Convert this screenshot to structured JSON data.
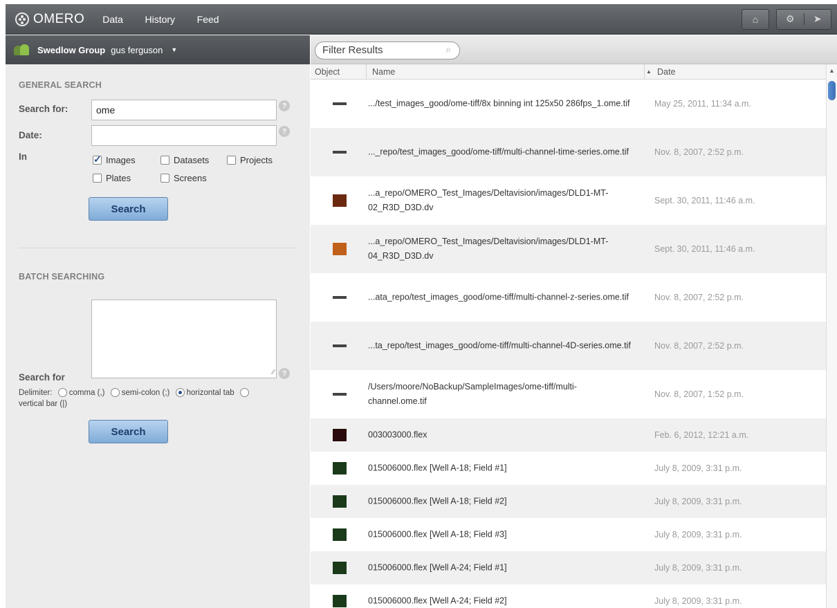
{
  "app": {
    "name": "OMERO",
    "nav": [
      "Data",
      "History",
      "Feed"
    ]
  },
  "group": {
    "name": "Swedlow Group",
    "user": "gus ferguson"
  },
  "general_search": {
    "title": "GENERAL SEARCH",
    "search_for_label": "Search for:",
    "search_for_value": "ome",
    "date_label": "Date:",
    "date_value": "",
    "in_label": "In",
    "scopes": [
      {
        "label": "Images",
        "checked": true
      },
      {
        "label": "Datasets",
        "checked": false
      },
      {
        "label": "Projects",
        "checked": false
      },
      {
        "label": "Plates",
        "checked": false
      },
      {
        "label": "Screens",
        "checked": false
      }
    ],
    "help": "?",
    "button": "Search"
  },
  "batch_search": {
    "title": "BATCH SEARCHING",
    "search_for_label": "Search for",
    "delimiter_label": "Delimiter:",
    "delimiters": [
      {
        "label": "comma (,)",
        "selected": false
      },
      {
        "label": "semi-colon (;)",
        "selected": false
      },
      {
        "label": "horizontal tab",
        "selected": true
      },
      {
        "label": "vertical bar (|)",
        "selected": false
      }
    ],
    "button": "Search"
  },
  "results": {
    "filter_placeholder": "Filter Results",
    "columns": [
      "Object",
      "Name",
      "Date"
    ],
    "rows": [
      {
        "name": ".../test_images_good/ome-tiff/8x binning int 125x50 286fps_1.ome.tif",
        "date": "May 25, 2011, 11:34 a.m.",
        "thumb": "line"
      },
      {
        "name": "..._repo/test_images_good/ome-tiff/multi-channel-time-series.ome.tif",
        "date": "Nov. 8, 2007, 2:52 p.m.",
        "thumb": "line"
      },
      {
        "name": "...a_repo/OMERO_Test_Images/Deltavision/images/DLD1-MT-02_R3D_D3D.dv",
        "date": "Sept. 30, 2011, 11:46 a.m.",
        "thumb": "#6b2a10"
      },
      {
        "name": "...a_repo/OMERO_Test_Images/Deltavision/images/DLD1-MT-04_R3D_D3D.dv",
        "date": "Sept. 30, 2011, 11:46 a.m.",
        "thumb": "#c0601a"
      },
      {
        "name": "...ata_repo/test_images_good/ome-tiff/multi-channel-z-series.ome.tif",
        "date": "Nov. 8, 2007, 2:52 p.m.",
        "thumb": "line"
      },
      {
        "name": "...ta_repo/test_images_good/ome-tiff/multi-channel-4D-series.ome.tif",
        "date": "Nov. 8, 2007, 2:52 p.m.",
        "thumb": "line"
      },
      {
        "name": "/Users/moore/NoBackup/SampleImages/ome-tiff/multi-channel.ome.tif",
        "date": "Nov. 8, 2007, 1:52 p.m.",
        "thumb": "line"
      },
      {
        "name": "003003000.flex",
        "date": "Feb. 6, 2012, 12:21 a.m.",
        "thumb": "#2a0a0a"
      },
      {
        "name": "015006000.flex [Well A-18; Field #1]",
        "date": "July 8, 2009, 3:31 p.m.",
        "thumb": "#1a3a1a"
      },
      {
        "name": "015006000.flex [Well A-18; Field #2]",
        "date": "July 8, 2009, 3:31 p.m.",
        "thumb": "#1a3a1a"
      },
      {
        "name": "015006000.flex [Well A-18; Field #3]",
        "date": "July 8, 2009, 3:31 p.m.",
        "thumb": "#1a3a1a"
      },
      {
        "name": "015006000.flex [Well A-24; Field #1]",
        "date": "July 8, 2009, 3:31 p.m.",
        "thumb": "#1a3a1a"
      },
      {
        "name": "015006000.flex [Well A-24; Field #2]",
        "date": "July 8, 2009, 3:31 p.m.",
        "thumb": "#1a3a1a"
      }
    ]
  }
}
